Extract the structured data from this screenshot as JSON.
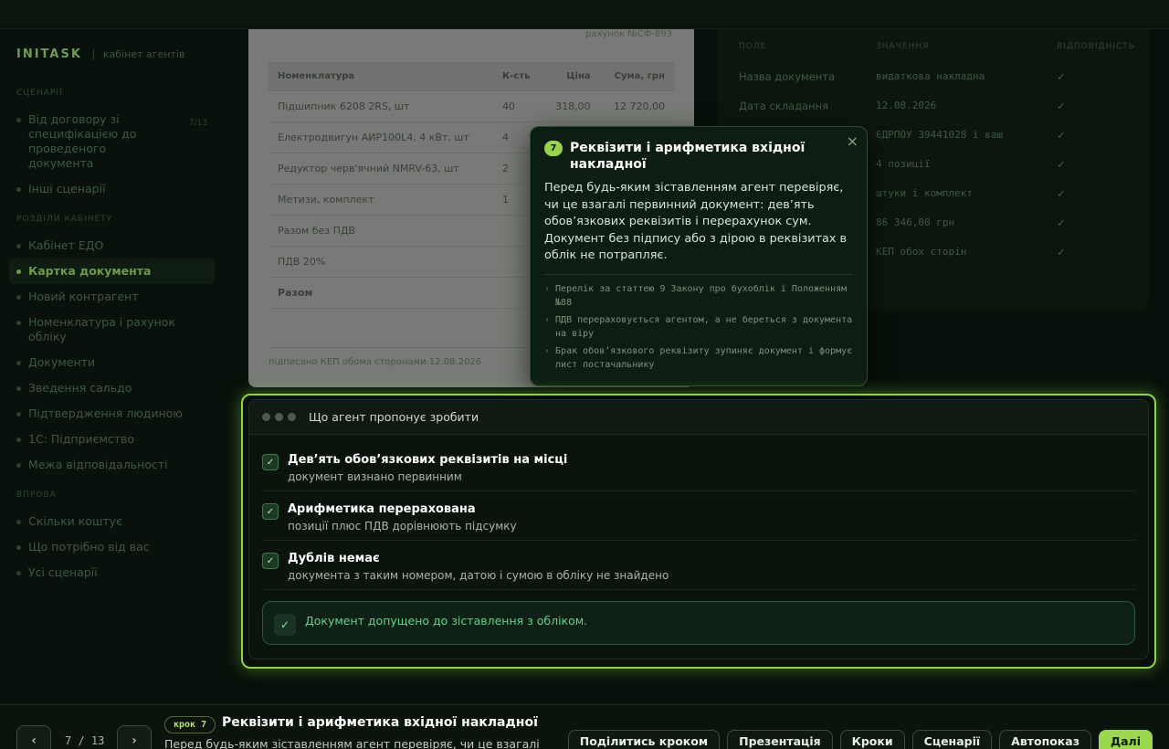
{
  "brand": {
    "logo": "INITASK",
    "subtitle": "кабінет агентів"
  },
  "sidebar": {
    "sections": [
      {
        "title": "СЦЕНАРІЇ",
        "items": [
          {
            "label": "Від договору зі специфікацією до проведеного документа",
            "count": "7/13"
          },
          {
            "label": "Інші сценарії"
          }
        ]
      },
      {
        "title": "РОЗДІЛИ КАБІНЕТУ",
        "items": [
          {
            "label": "Кабінет ЕДО"
          },
          {
            "label": "Картка документа",
            "active": true
          },
          {
            "label": "Новий контрагент"
          },
          {
            "label": "Номенклатура і рахунок обліку"
          },
          {
            "label": "Документи"
          },
          {
            "label": "Зведення сальдо"
          },
          {
            "label": "Підтвердження людиною"
          },
          {
            "label": "1С: Підприємство"
          },
          {
            "label": "Межа відповідальності"
          }
        ]
      },
      {
        "title": "ВПРОВА",
        "items": [
          {
            "label": "Скільки коштує"
          },
          {
            "label": "Що потрібно від вас"
          },
          {
            "label": "Усі сценарії"
          }
        ]
      }
    ]
  },
  "document": {
    "ref": "рахунок №СФ-893",
    "headers": [
      "Номенклатура",
      "К-сть",
      "Ціна",
      "Сума, грн"
    ],
    "rows": [
      [
        "Підшипник 6208 2RS, шт",
        "40",
        "318,00",
        "12 720,00"
      ],
      [
        "Електродвигун АИР100L4, 4 кВт, шт",
        "4",
        "",
        ""
      ],
      [
        "Редуктор черв'ячний NMRV-63, шт",
        "2",
        "",
        ""
      ],
      [
        "Метизи, комплект",
        "1",
        "",
        ""
      ],
      [
        "Разом без ПДВ",
        "",
        "",
        ""
      ],
      [
        "ПДВ 20%",
        "",
        "",
        ""
      ],
      [
        "Разом",
        "",
        "",
        ""
      ]
    ],
    "footer": "підписано КЕП обома сторонами 12.08.2026"
  },
  "right_table": {
    "headers": [
      "ПОЛЕ",
      "ЗНАЧЕННЯ",
      "ВІДПОВІДНІСТЬ"
    ],
    "rows": [
      {
        "field": "Назва документа",
        "value": "видаткова накладна",
        "ok": "✓"
      },
      {
        "field": "Дата складання",
        "value": "12.08.2026",
        "ok": "✓"
      },
      {
        "field": "",
        "value": "ЄДРПОУ 39441028 і ваш",
        "ok": "✓"
      },
      {
        "field": "",
        "value": "4 позиції",
        "ok": "✓"
      },
      {
        "field": "",
        "value": "штуки і комплект",
        "ok": "✓"
      },
      {
        "field": "",
        "value": "86 346,00 грн",
        "ok": "✓"
      },
      {
        "field": "",
        "value": "КЕП обох сторін",
        "ok": "✓"
      }
    ]
  },
  "tooltip": {
    "step": "7",
    "title": "Реквізити і арифметика вхідної накладної",
    "body": "Перед будь-яким зіставленням агент перевіряє, чи це взагалі первинний документ: дев’ять обов’язкових реквізитів і перерахунок сум. Документ без підпису або з дірою в реквізитах в облік не потрапляє.",
    "bullets": [
      "Перелік за статтею 9 Закону про бухоблік і Положенням №88",
      "ПДВ перераховується агентом, а не береться з документа на віру",
      "Брак обов’язкового реквізиту зупиняє документ і формує лист постачальнику"
    ],
    "close": "×"
  },
  "agent": {
    "title": "Що агент пропонує зробити",
    "checks": [
      {
        "title": "Дев’ять обов’язкових реквізитів на місці",
        "sub": "документ визнано первинним"
      },
      {
        "title": "Арифметика перерахована",
        "sub": "позиції плюс ПДВ дорівнюють підсумку"
      },
      {
        "title": "Дублів немає",
        "sub": "документа з таким номером, датою і сумою в обліку не знайдено"
      }
    ],
    "check_mark": "✓",
    "result": "Документ допущено до зіставлення з обліком."
  },
  "bottom": {
    "prev": "‹",
    "next": "›",
    "pager": "7 / 13",
    "step_badge": "крок 7",
    "step_title": "Реквізити і арифметика вхідної накладної",
    "step_desc": "Перед будь-яким зіставленням агент перевіряє, чи це взагалі",
    "buttons": {
      "share": "Поділитись кроком",
      "present": "Презентація",
      "steps": "Кроки",
      "scenarios": "Сценарії",
      "autoplay": "Автопоказ",
      "next": "Далі"
    }
  },
  "colors": {
    "accent": "#9bd84f",
    "ok": "#62d28c",
    "bg": "#07100a"
  }
}
